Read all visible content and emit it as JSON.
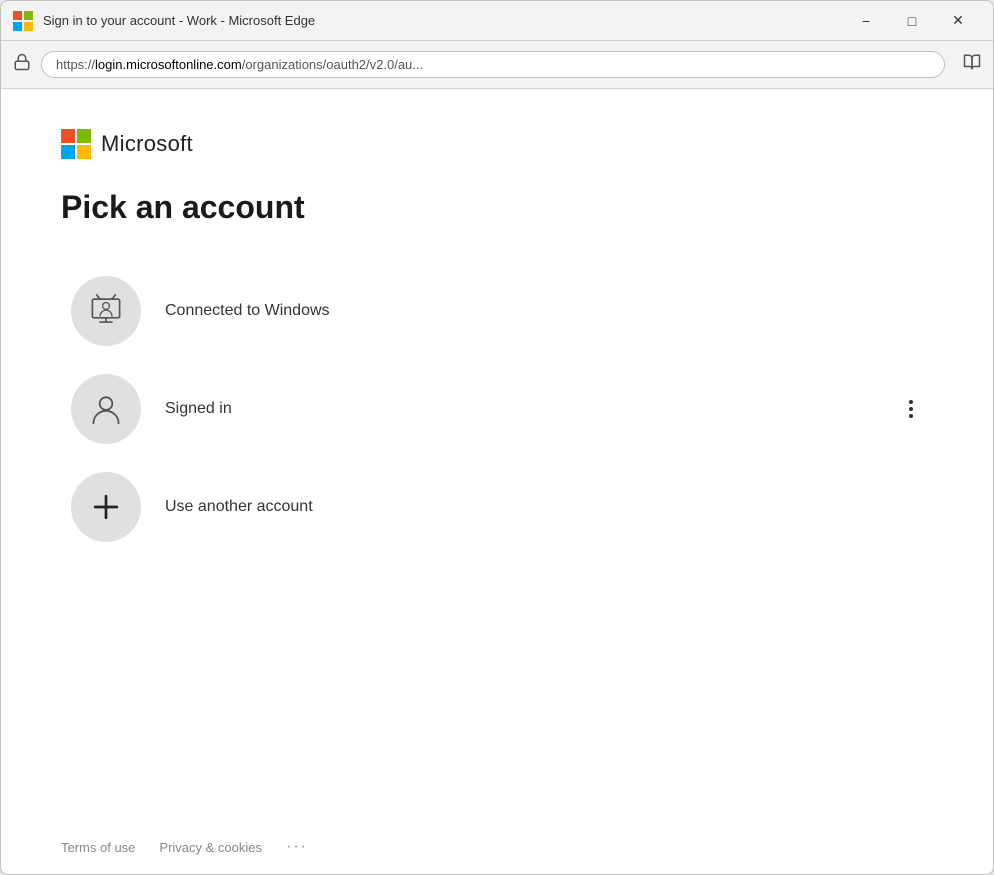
{
  "window": {
    "title": "Sign in to your account - Work - Microsoft Edge",
    "minimize_label": "−",
    "maximize_label": "□",
    "close_label": "✕"
  },
  "address_bar": {
    "url_prefix": "https://",
    "url_bold": "login.microsoftonline.com",
    "url_suffix": "/organizations/oauth2/v2.0/au..."
  },
  "brand": {
    "name": "Microsoft",
    "colors": {
      "red": "#f25022",
      "green": "#7fba00",
      "blue": "#00a4ef",
      "yellow": "#ffb900"
    }
  },
  "page": {
    "heading": "Pick an account",
    "accounts": [
      {
        "id": "connected-windows",
        "label": "Connected to Windows",
        "avatar_type": "tv-person",
        "has_more": false
      },
      {
        "id": "signed-in",
        "label": "Signed in",
        "avatar_type": "person",
        "has_more": true
      },
      {
        "id": "use-another",
        "label": "Use another account",
        "avatar_type": "plus",
        "has_more": false
      }
    ]
  },
  "footer": {
    "terms_label": "Terms of use",
    "privacy_label": "Privacy & cookies",
    "more_label": "···"
  }
}
